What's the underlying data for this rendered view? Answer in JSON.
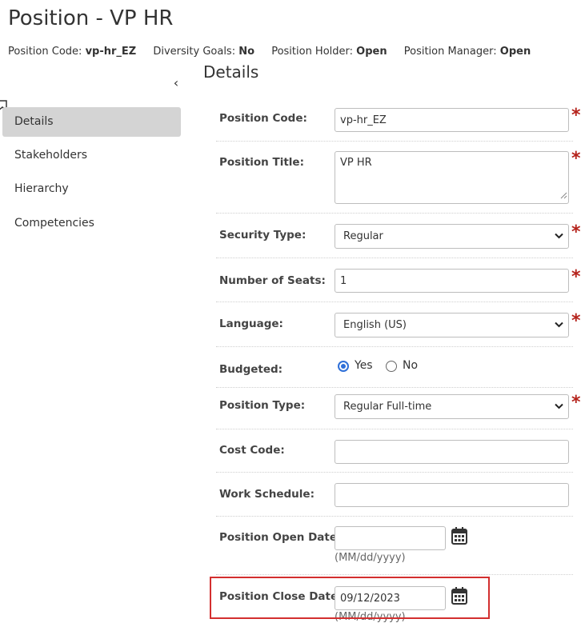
{
  "header": {
    "title": "Position - VP HR",
    "meta": [
      {
        "label": "Position Code:",
        "value": "vp-hr_EZ"
      },
      {
        "label": "Diversity Goals:",
        "value": "No"
      },
      {
        "label": "Position Holder:",
        "value": "Open"
      },
      {
        "label": "Position Manager:",
        "value": "Open"
      }
    ]
  },
  "sidebar": {
    "collapse_glyph": "‹",
    "items": [
      {
        "label": "Details",
        "active": true
      },
      {
        "label": "Stakeholders"
      },
      {
        "label": "Hierarchy"
      },
      {
        "label": "Competencies"
      }
    ]
  },
  "main": {
    "section_title": "Details",
    "required_mark": "*",
    "fields": {
      "position_code": {
        "label": "Position Code:",
        "value": "vp-hr_EZ"
      },
      "position_title": {
        "label": "Position Title:",
        "value": "VP HR"
      },
      "security_type": {
        "label": "Security Type:",
        "value": "Regular"
      },
      "number_of_seats": {
        "label": "Number of Seats:",
        "value": "1"
      },
      "language": {
        "label": "Language:",
        "value": "English (US)"
      },
      "budgeted": {
        "label": "Budgeted:",
        "options": [
          "Yes",
          "No"
        ],
        "selected": "Yes"
      },
      "position_type": {
        "label": "Position Type:",
        "value": "Regular Full-time"
      },
      "cost_code": {
        "label": "Cost Code:",
        "value": ""
      },
      "work_schedule": {
        "label": "Work Schedule:",
        "value": ""
      },
      "position_open_date": {
        "label": "Position Open Date:",
        "value": "",
        "format_hint": "(MM/dd/yyyy)"
      },
      "position_close_date": {
        "label": "Position Close Date:",
        "value": "09/12/2023",
        "format_hint": "(MM/dd/yyyy)"
      }
    }
  },
  "colors": {
    "required": "#b5231c",
    "radio_accent": "#2f70d8",
    "highlight_border": "#d32f2f",
    "active_nav_bg": "#d4d4d4"
  }
}
